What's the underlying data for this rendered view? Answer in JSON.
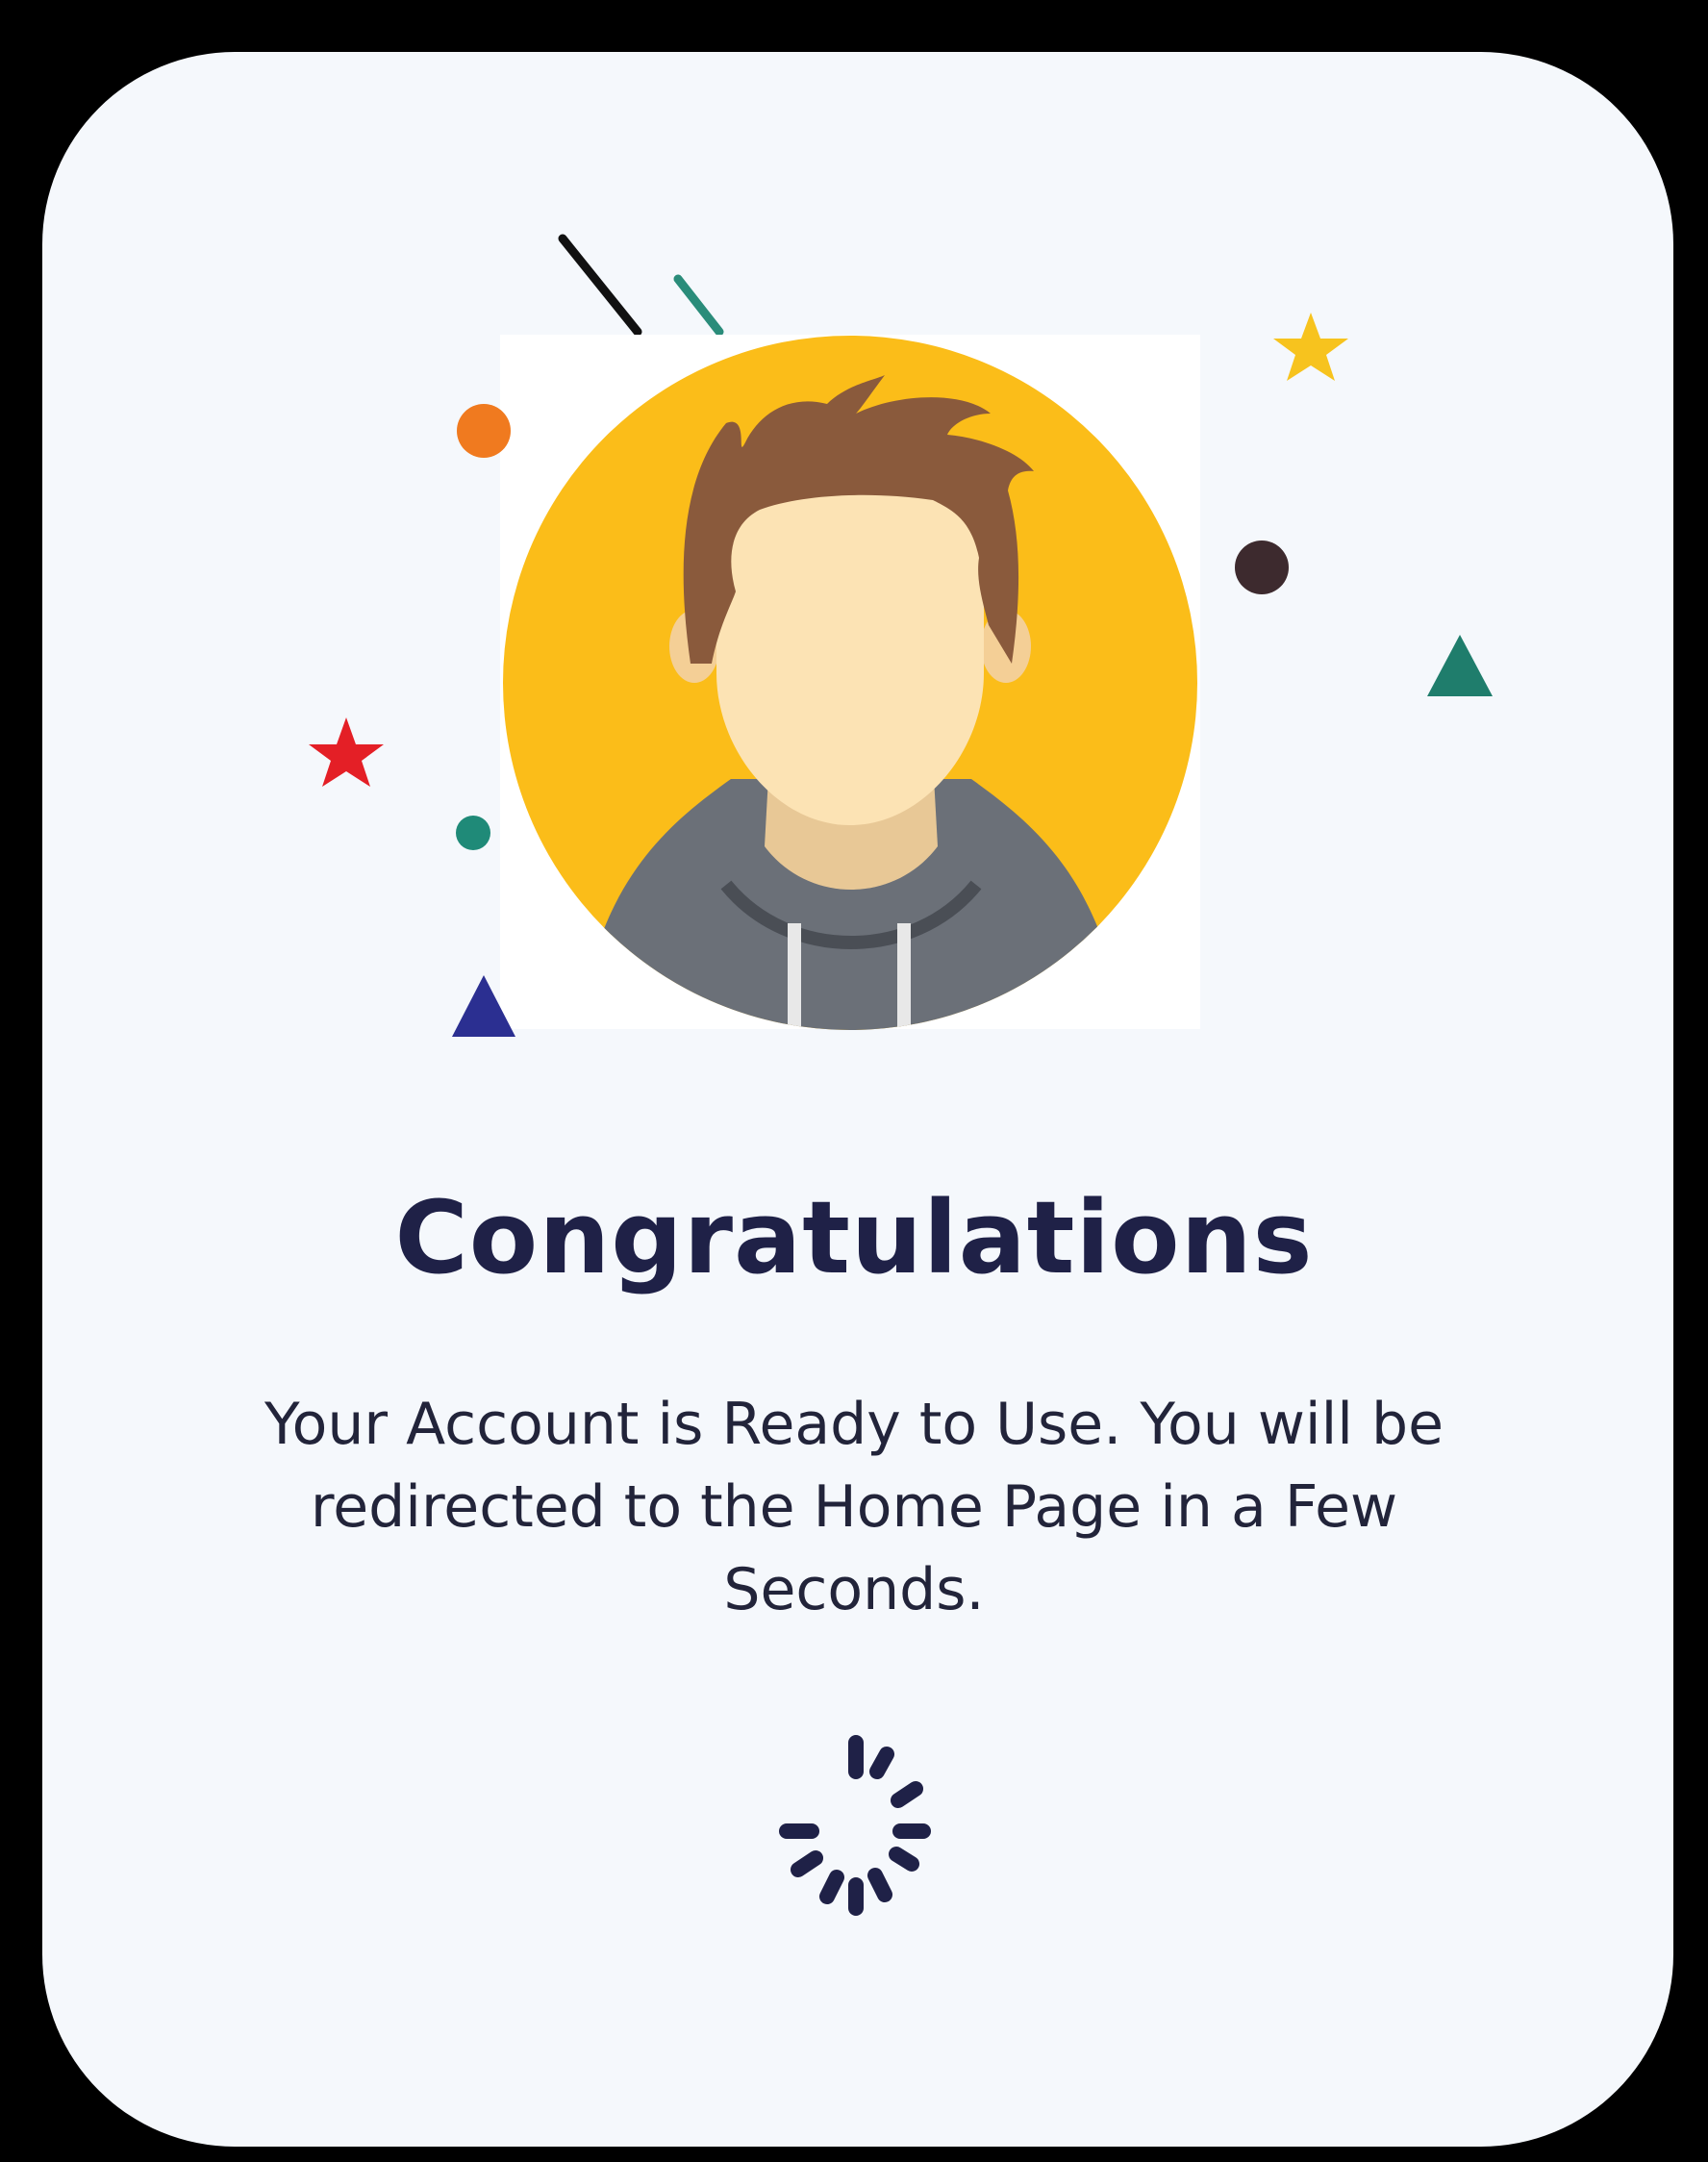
{
  "screen": {
    "title": "Congratulations",
    "message": "Your Account is Ready to Use. You will be redirected to the Home Page in a Few Seconds."
  },
  "colors": {
    "card_background": "#f5f8fc",
    "title": "#1f2147",
    "avatar_circle": "#fbbd19",
    "hair": "#8a5a3c",
    "hoodie": "#6b7078",
    "face": "#fce3b4",
    "spinner": "#1f2147"
  },
  "icons": [
    "avatar-icon",
    "loading-spinner-icon",
    "confetti-decoration"
  ]
}
